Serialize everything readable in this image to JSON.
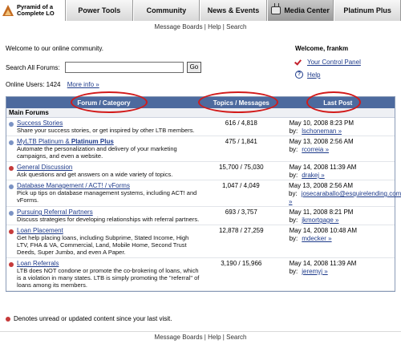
{
  "logo": {
    "line1": "Pyramid of a",
    "line2": "Complete LO"
  },
  "nav": {
    "tabs": [
      "Power Tools",
      "Community",
      "News & Events",
      "Media Center",
      "Platinum Plus"
    ]
  },
  "subnav": {
    "message_boards": "Message Boards",
    "sep1": "|",
    "help": "Help",
    "sep2": "|",
    "search": "Search"
  },
  "welcome": "Welcome to our online community.",
  "search": {
    "label": "Search All Forums:",
    "value": "",
    "button": "Go"
  },
  "online": {
    "label": "Online Users: 1424",
    "more": "More info »"
  },
  "user": {
    "name": "Welcome, frankm",
    "control_panel": "Your Control Panel",
    "help": "Help"
  },
  "table": {
    "headers": {
      "category": "Forum / Category",
      "topics": "Topics / Messages",
      "last": "Last Post"
    },
    "section": "Main Forums",
    "by_label": "by:",
    "rows": [
      {
        "title": "Success Stories",
        "title_extra": "",
        "desc": "Share your success stories, or get inspired by other LTB members.",
        "counts": "616 / 4,818",
        "date": "May 10, 2008 8:23 PM",
        "user": "lschoneman »",
        "dot": "#7b93c4"
      },
      {
        "title": "MyLTB Platinum & ",
        "title_extra": "Platinum Plus",
        "desc": "Automate the personalization and delivery of your marketing campaigns, and even a website.",
        "counts": "475 / 1,841",
        "date": "May 13, 2008 2:56 AM",
        "user": "rcorreia »",
        "dot": "#7b93c4"
      },
      {
        "title": "General Discussion",
        "title_extra": "",
        "desc": "Ask questions and get answers on a wide variety of topics.",
        "counts": "15,700 / 75,030",
        "date": "May 14, 2008 11:39 AM",
        "user": "drakej »",
        "dot": "#c63a3a"
      },
      {
        "title": "Database Management / ACT! / vForms",
        "title_extra": "",
        "desc": "Pick up tips on database management systems, including ACT! and vForms.",
        "counts": "1,047 / 4,049",
        "date": "May 13, 2008 2:56 AM",
        "user": "josecaraballo@esquirelending.com »",
        "dot": "#7b93c4"
      },
      {
        "title": "Pursuing Referral Partners",
        "title_extra": "",
        "desc": "Discuss strategies for developing relationships with referral partners.",
        "counts": "693 / 3,757",
        "date": "May 11, 2008 8:21 PM",
        "user": "jkmortgage »",
        "dot": "#7b93c4"
      },
      {
        "title": "Loan Placement",
        "title_extra": "",
        "desc": "Get help placing loans, including Subprime, Stated Income, High LTV, FHA & VA, Commercial, Land, Mobile Home, Second Trust Deeds, Super Jumbo, and even A Paper.",
        "counts": "12,878 / 27,259",
        "date": "May 14, 2008 10:48 AM",
        "user": "mdecker »",
        "dot": "#c63a3a"
      },
      {
        "title": "Loan Referrals",
        "title_extra": "",
        "desc": "LTB does NOT condone or promote the co-brokering of loans, which is a violation in many states. LTB is simply promoting the \"referral\" of loans among its members.",
        "counts": "3,190 / 15,966",
        "date": "May 14, 2008 11:39 AM",
        "user": "jeremyj »",
        "dot": "#c63a3a"
      }
    ]
  },
  "legend": "Denotes unread or updated content since your last visit."
}
